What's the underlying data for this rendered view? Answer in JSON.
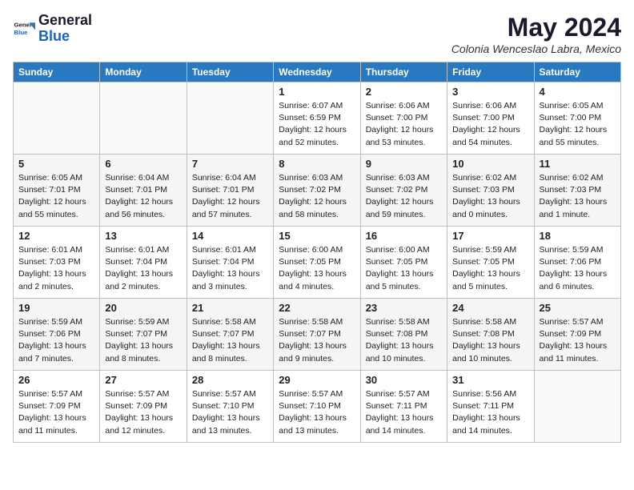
{
  "header": {
    "logo_general": "General",
    "logo_blue": "Blue",
    "month": "May 2024",
    "location": "Colonia Wenceslao Labra, Mexico"
  },
  "days_of_week": [
    "Sunday",
    "Monday",
    "Tuesday",
    "Wednesday",
    "Thursday",
    "Friday",
    "Saturday"
  ],
  "weeks": [
    [
      {
        "day": "",
        "info": ""
      },
      {
        "day": "",
        "info": ""
      },
      {
        "day": "",
        "info": ""
      },
      {
        "day": "1",
        "info": "Sunrise: 6:07 AM\nSunset: 6:59 PM\nDaylight: 12 hours\nand 52 minutes."
      },
      {
        "day": "2",
        "info": "Sunrise: 6:06 AM\nSunset: 7:00 PM\nDaylight: 12 hours\nand 53 minutes."
      },
      {
        "day": "3",
        "info": "Sunrise: 6:06 AM\nSunset: 7:00 PM\nDaylight: 12 hours\nand 54 minutes."
      },
      {
        "day": "4",
        "info": "Sunrise: 6:05 AM\nSunset: 7:00 PM\nDaylight: 12 hours\nand 55 minutes."
      }
    ],
    [
      {
        "day": "5",
        "info": "Sunrise: 6:05 AM\nSunset: 7:01 PM\nDaylight: 12 hours\nand 55 minutes."
      },
      {
        "day": "6",
        "info": "Sunrise: 6:04 AM\nSunset: 7:01 PM\nDaylight: 12 hours\nand 56 minutes."
      },
      {
        "day": "7",
        "info": "Sunrise: 6:04 AM\nSunset: 7:01 PM\nDaylight: 12 hours\nand 57 minutes."
      },
      {
        "day": "8",
        "info": "Sunrise: 6:03 AM\nSunset: 7:02 PM\nDaylight: 12 hours\nand 58 minutes."
      },
      {
        "day": "9",
        "info": "Sunrise: 6:03 AM\nSunset: 7:02 PM\nDaylight: 12 hours\nand 59 minutes."
      },
      {
        "day": "10",
        "info": "Sunrise: 6:02 AM\nSunset: 7:03 PM\nDaylight: 13 hours\nand 0 minutes."
      },
      {
        "day": "11",
        "info": "Sunrise: 6:02 AM\nSunset: 7:03 PM\nDaylight: 13 hours\nand 1 minute."
      }
    ],
    [
      {
        "day": "12",
        "info": "Sunrise: 6:01 AM\nSunset: 7:03 PM\nDaylight: 13 hours\nand 2 minutes."
      },
      {
        "day": "13",
        "info": "Sunrise: 6:01 AM\nSunset: 7:04 PM\nDaylight: 13 hours\nand 2 minutes."
      },
      {
        "day": "14",
        "info": "Sunrise: 6:01 AM\nSunset: 7:04 PM\nDaylight: 13 hours\nand 3 minutes."
      },
      {
        "day": "15",
        "info": "Sunrise: 6:00 AM\nSunset: 7:05 PM\nDaylight: 13 hours\nand 4 minutes."
      },
      {
        "day": "16",
        "info": "Sunrise: 6:00 AM\nSunset: 7:05 PM\nDaylight: 13 hours\nand 5 minutes."
      },
      {
        "day": "17",
        "info": "Sunrise: 5:59 AM\nSunset: 7:05 PM\nDaylight: 13 hours\nand 5 minutes."
      },
      {
        "day": "18",
        "info": "Sunrise: 5:59 AM\nSunset: 7:06 PM\nDaylight: 13 hours\nand 6 minutes."
      }
    ],
    [
      {
        "day": "19",
        "info": "Sunrise: 5:59 AM\nSunset: 7:06 PM\nDaylight: 13 hours\nand 7 minutes."
      },
      {
        "day": "20",
        "info": "Sunrise: 5:59 AM\nSunset: 7:07 PM\nDaylight: 13 hours\nand 8 minutes."
      },
      {
        "day": "21",
        "info": "Sunrise: 5:58 AM\nSunset: 7:07 PM\nDaylight: 13 hours\nand 8 minutes."
      },
      {
        "day": "22",
        "info": "Sunrise: 5:58 AM\nSunset: 7:07 PM\nDaylight: 13 hours\nand 9 minutes."
      },
      {
        "day": "23",
        "info": "Sunrise: 5:58 AM\nSunset: 7:08 PM\nDaylight: 13 hours\nand 10 minutes."
      },
      {
        "day": "24",
        "info": "Sunrise: 5:58 AM\nSunset: 7:08 PM\nDaylight: 13 hours\nand 10 minutes."
      },
      {
        "day": "25",
        "info": "Sunrise: 5:57 AM\nSunset: 7:09 PM\nDaylight: 13 hours\nand 11 minutes."
      }
    ],
    [
      {
        "day": "26",
        "info": "Sunrise: 5:57 AM\nSunset: 7:09 PM\nDaylight: 13 hours\nand 11 minutes."
      },
      {
        "day": "27",
        "info": "Sunrise: 5:57 AM\nSunset: 7:09 PM\nDaylight: 13 hours\nand 12 minutes."
      },
      {
        "day": "28",
        "info": "Sunrise: 5:57 AM\nSunset: 7:10 PM\nDaylight: 13 hours\nand 13 minutes."
      },
      {
        "day": "29",
        "info": "Sunrise: 5:57 AM\nSunset: 7:10 PM\nDaylight: 13 hours\nand 13 minutes."
      },
      {
        "day": "30",
        "info": "Sunrise: 5:57 AM\nSunset: 7:11 PM\nDaylight: 13 hours\nand 14 minutes."
      },
      {
        "day": "31",
        "info": "Sunrise: 5:56 AM\nSunset: 7:11 PM\nDaylight: 13 hours\nand 14 minutes."
      },
      {
        "day": "",
        "info": ""
      }
    ]
  ]
}
